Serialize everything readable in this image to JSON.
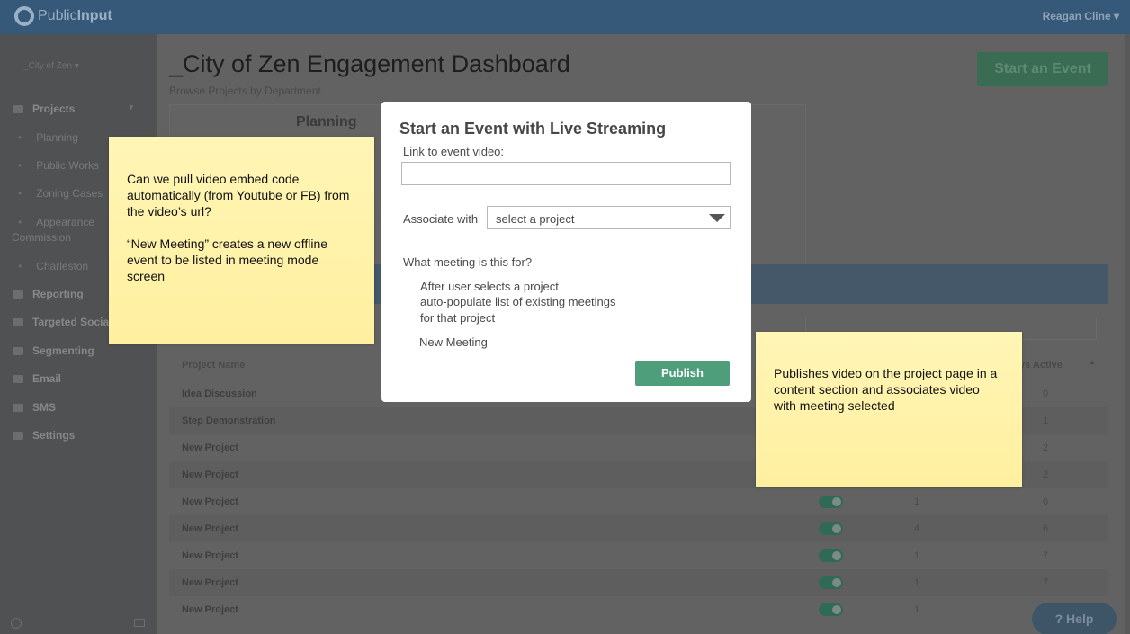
{
  "app": {
    "logo_left": "Public",
    "logo_right": "Input",
    "user_name": "Reagan Cline"
  },
  "sidebar": {
    "org": "_City of Zen",
    "items": [
      {
        "label": "Projects",
        "icon": "chat-icon",
        "head": true
      },
      {
        "label": "Planning",
        "sub": true
      },
      {
        "label": "Public Works",
        "sub": true
      },
      {
        "label": "Zoning Cases",
        "sub": true
      },
      {
        "label": "Appearance",
        "sub": true
      },
      {
        "label": "Commission",
        "sub": true
      },
      {
        "label": "Charleston",
        "sub": true
      },
      {
        "label": "Reporting",
        "icon": "chart-icon",
        "head": true
      },
      {
        "label": "Targeted Social",
        "icon": "megaphone-icon",
        "head": true
      },
      {
        "label": "Segmenting",
        "icon": "users-icon",
        "head": true
      },
      {
        "label": "Email",
        "icon": "mail-icon",
        "head": true
      },
      {
        "label": "SMS",
        "icon": "sms-icon",
        "head": true
      },
      {
        "label": "Settings",
        "icon": "gear-icon",
        "head": true
      }
    ]
  },
  "main": {
    "title": "_City of Zen Engagement Dashboard",
    "subtitle": "Browse Projects by Department",
    "start_event_label": "Start an Event",
    "dept_tab": "Planning",
    "columns": {
      "name": "Project Name",
      "days": "ys Active"
    },
    "rows": [
      {
        "name": "Idea Discussion",
        "c1": "",
        "c2": "0",
        "toggle": false
      },
      {
        "name": "Step Demonstration",
        "c1": "",
        "c2": "1",
        "toggle": false
      },
      {
        "name": "New Project",
        "c1": "",
        "c2": "2",
        "toggle": false
      },
      {
        "name": "New Project",
        "c1": "",
        "c2": "2",
        "toggle": false
      },
      {
        "name": "New Project",
        "c1": "1",
        "c2": "6",
        "toggle": true
      },
      {
        "name": "New Project",
        "c1": "4",
        "c2": "6",
        "toggle": true
      },
      {
        "name": "New Project",
        "c1": "1",
        "c2": "7",
        "toggle": true
      },
      {
        "name": "New Project",
        "c1": "1",
        "c2": "7",
        "toggle": true
      },
      {
        "name": "New Project",
        "c1": "1",
        "c2": "",
        "toggle": true
      }
    ],
    "help_label": "Help"
  },
  "modal": {
    "title": "Start an Event with Live Streaming",
    "video_label": "Link to event video:",
    "video_value": "",
    "associate_label": "Associate with",
    "project_select_value": "select a project",
    "meeting_question": "What meeting is this for?",
    "note_lines": [
      "After user selects a project",
      "auto-populate list of existing meetings",
      "for that project"
    ],
    "new_meeting_label": "New Meeting",
    "publish_label": "Publish"
  },
  "stickies": {
    "left_p1": "Can we pull video embed code automatically (from Youtube or FB) from the video’s url?",
    "left_p2": "“New Meeting” creates a new offline event to be listed in meeting mode screen",
    "right": "Publishes video on the project page in a content section and associates video with meeting selected"
  },
  "colors": {
    "topbar": "#36597a",
    "primary_green": "#4e9e7b",
    "sticky_yellow": "#fff3a8"
  }
}
